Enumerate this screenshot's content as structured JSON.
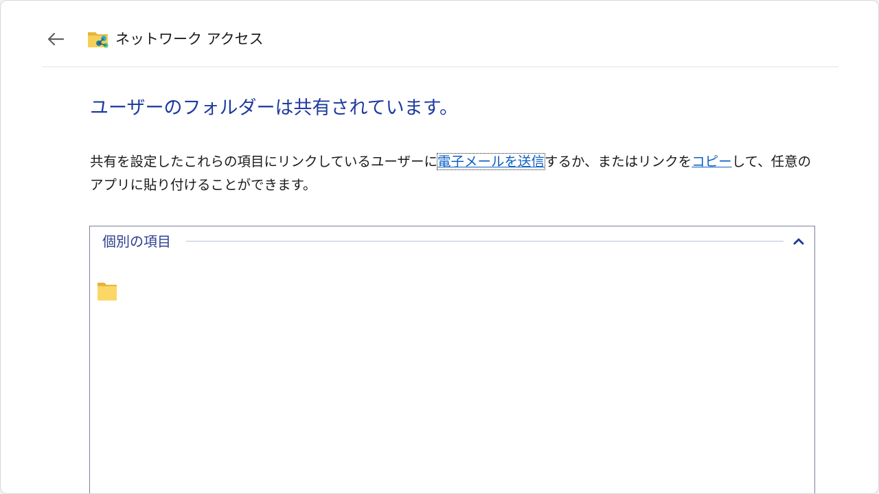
{
  "window": {
    "title": "ネットワーク アクセス"
  },
  "heading": "ユーザーのフォルダーは共有されています。",
  "description": {
    "part1": "共有を設定したこれらの項目にリンクしているユーザーに",
    "email_link": "電子メールを送信",
    "part2": "するか、またはリンクを",
    "copy_link": "コピー",
    "part3": "して、任意のアプリに貼り付けることができます。"
  },
  "group": {
    "title": "個別の項目",
    "items": [
      {
        "icon": "folder-icon",
        "label": ""
      }
    ]
  },
  "icons": {
    "back": "back-arrow-icon",
    "title": "network-folder-icon",
    "collapse": "chevron-up-icon"
  },
  "colors": {
    "heading": "#1e3b9e",
    "link": "#0b5fc6",
    "group_title": "#2c3e8f",
    "group_border": "#7c7f98"
  }
}
